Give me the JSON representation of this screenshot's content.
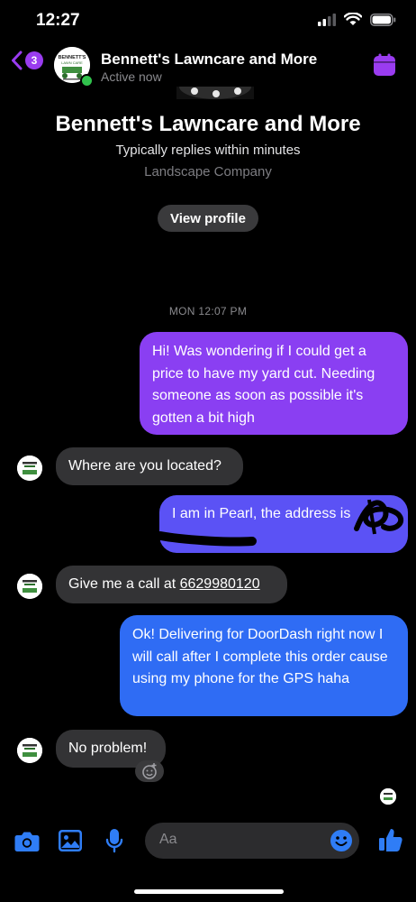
{
  "status_bar": {
    "time": "12:27"
  },
  "header": {
    "back_badge": "3",
    "name": "Bennett's Lawncare and More",
    "status": "Active now",
    "accent_color": "#9a3cf0"
  },
  "avatar_logo": {
    "line1": "BENNETT'S",
    "line2": "LAWN CARE"
  },
  "profile": {
    "name": "Bennett's Lawncare and More",
    "replies": "Typically replies within minutes",
    "category": "Landscape Company",
    "view_profile": "View profile"
  },
  "timestamp": "MON 12:07 PM",
  "messages": [
    {
      "from": "me",
      "text": "Hi! Was wondering if I could get a price to have my yard cut. Needing someone as soon as possible it's gotten a bit high"
    },
    {
      "from": "them",
      "text": "Where are you located?"
    },
    {
      "from": "me",
      "text": "I am in Pearl, the address is"
    },
    {
      "from": "them",
      "prefix": "Give me a call at ",
      "phone": "6629980120"
    },
    {
      "from": "me",
      "text": "Ok! Delivering for DoorDash right now I will call after I complete this order cause using my phone for the GPS haha"
    },
    {
      "from": "them",
      "text": "No problem!"
    }
  ],
  "composer": {
    "placeholder": "Aa"
  },
  "colors": {
    "bubble_top": "#8a3ff2",
    "bubble_bottom": "#2f6cf4",
    "incoming": "#333335",
    "icon_blue": "#2f7df6"
  },
  "icons": [
    "back-chevron-icon",
    "calendar-icon",
    "camera-icon",
    "gallery-icon",
    "microphone-icon",
    "emoji-icon",
    "thumbs-up-icon",
    "add-reaction-icon"
  ]
}
